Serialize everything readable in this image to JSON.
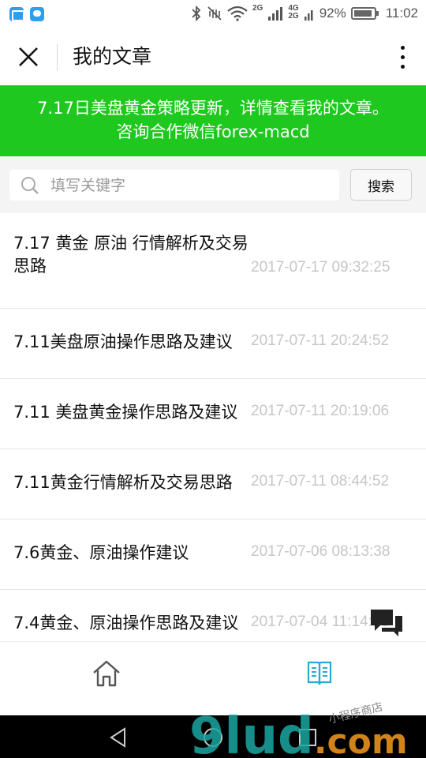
{
  "status_bar": {
    "icons": [
      "gallery-icon",
      "message-icon",
      "bluetooth-icon",
      "vibrate-off-icon",
      "wifi-icon",
      "signal-icon"
    ],
    "network_1": "2G",
    "network_2": "4G",
    "network_3": "2G",
    "battery_percent": "92%",
    "battery_level": 0.92,
    "time": "11:02"
  },
  "navbar": {
    "title": "我的文章"
  },
  "banner": {
    "text": "7.17日美盘黄金策略更新，详情查看我的文章。咨询合作微信forex-macd",
    "background": "#1ec81e"
  },
  "search": {
    "placeholder": "填写关键字",
    "value": "",
    "button_label": "搜索"
  },
  "articles": [
    {
      "title": "7.17 黄金 原油 行情解析及交易思路",
      "date": "2017-07-17 09:32:25"
    },
    {
      "title": "7.11美盘原油操作思路及建议",
      "date": "2017-07-11 20:24:52"
    },
    {
      "title": "7.11 美盘黄金操作思路及建议",
      "date": "2017-07-11 20:19:06"
    },
    {
      "title": "7.11黄金行情解析及交易思路",
      "date": "2017-07-11 08:44:52"
    },
    {
      "title": "7.6黄金、原油操作建议",
      "date": "2017-07-06 08:13:38"
    },
    {
      "title": "7.4黄金、原油操作思路及建议",
      "date": "2017-07-04 11:14:18"
    }
  ],
  "tabbar": {
    "tabs": [
      {
        "icon": "home-icon",
        "active": false
      },
      {
        "icon": "article-book-icon",
        "active": true
      }
    ],
    "active_color": "#2aa8d8"
  },
  "watermark": {
    "text": "9lud.com",
    "subtext": "小程序商店"
  }
}
